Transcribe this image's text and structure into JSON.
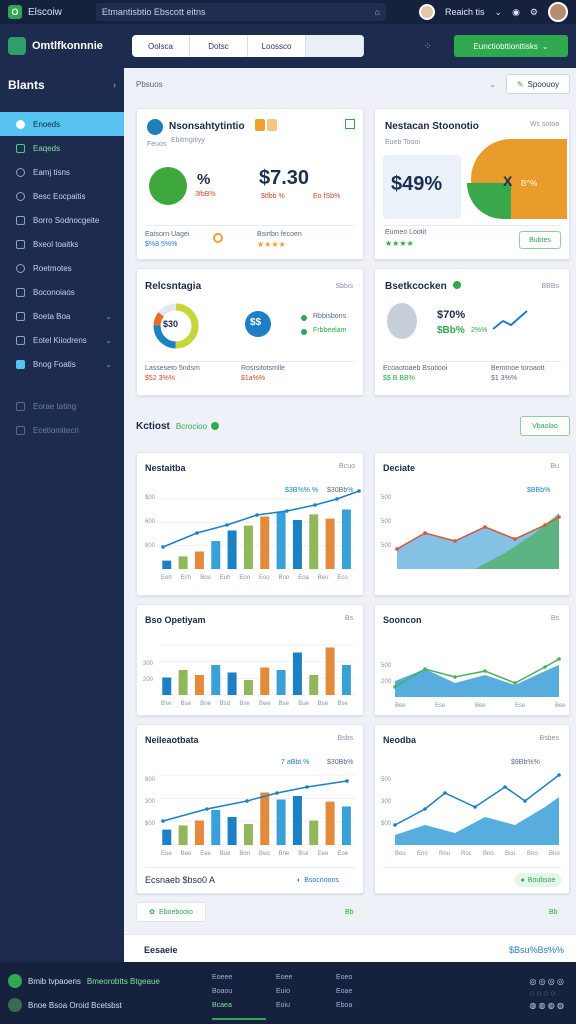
{
  "topbar": {
    "app_name": "Elscoiw",
    "search_text": "Etmantisbtio Ebscott eitns",
    "user_name": "Reaich tis"
  },
  "header": {
    "brand": "Omtlfkonnnie",
    "tabs": [
      "Oolsca",
      "Dotsc",
      "Loossco",
      ""
    ],
    "cta": "Eunctiobttionttisks"
  },
  "sidebar": {
    "title": "Blants",
    "items": [
      {
        "label": "Enoeds"
      },
      {
        "label": "Eaqeds"
      },
      {
        "label": "Eamj tisns"
      },
      {
        "label": "Besc Eocpaitis"
      },
      {
        "label": "Borro Sodnocgeite"
      },
      {
        "label": "Bxeol toaitks"
      },
      {
        "label": "Roetmotes"
      },
      {
        "label": "Boconoiaos"
      },
      {
        "label": "Boeta Boa"
      },
      {
        "label": "Eotel Kiiodrens"
      },
      {
        "label": "Bnog Foatis"
      },
      {
        "label": "Eorae tating"
      },
      {
        "label": "Ecetiomitecn"
      }
    ]
  },
  "filter": {
    "label": "Pbsuos",
    "button": "Spoouoy"
  },
  "cards": {
    "c1": {
      "title": "Nsonsahtytintio",
      "sub": "Feuos",
      "sub2": "Ebitmgitiyy",
      "badge": "%",
      "pct": "3fbB%",
      "value": "$7.30",
      "value_sub": "$tfbb %",
      "value_sub2": "Eo fSb%",
      "foot_left": "Eatsorn Uagei",
      "foot_left2": "$%8 5%%",
      "foot_right": "Bsirtbn fecoen"
    },
    "c2": {
      "title": "Nestacan Stoonotio",
      "tag": "Ws sotoa",
      "sub": "Eueb Toooi",
      "value": "$49%",
      "x": "X",
      "xp": "B^%",
      "foot": "Eumeo Lootit",
      "btn": "Bubtes"
    },
    "c3": {
      "title": "Relcsntagia",
      "tag": "Sbbis",
      "donut": "$30",
      "blue_txt": "$$",
      "item1": "Rbbisbons",
      "item2": "Frbbeelam",
      "foot_left": "Lasseseto 5ndsm",
      "foot_left2": "$52 3%%",
      "foot_right": "Rosrsitotsmlle",
      "foot_right2": "$1a%%"
    },
    "c4": {
      "title": "Bsetkcocken",
      "tag": "BBBs",
      "val": "$70%",
      "val2": "$Bb%",
      "val3": "2%%",
      "foot_left": "Ecoaotoaeb Bsotiooi",
      "foot_left2": "$$ B.BB%",
      "foot_right": "Bemtnoe toroaott",
      "foot_right2": "$1 3%%"
    }
  },
  "section": {
    "title": "Kctiost",
    "chip": "Bcrocioo",
    "button": "Vbaolao"
  },
  "charts": {
    "a": {
      "title": "Nestaitba",
      "tag": "Bcuo",
      "legend": "$3B%% %",
      "legend2": "$30Bb%",
      "ticks": [
        "Eeh",
        "Ech",
        "Bou",
        "Euh",
        "Eoo",
        "Eoo",
        "Bno",
        "Eoa",
        "Beo",
        "Eco"
      ]
    },
    "b": {
      "title": "Deciate",
      "tag": "Bu",
      "legend": "$BBb%"
    },
    "c": {
      "title": "Bso Opetiyam",
      "tag": "Bs",
      "ticks": [
        "Bse",
        "Bse",
        "Bne",
        "Bsd",
        "Bse",
        "Bwe",
        "Bse",
        "Bue",
        "Bse",
        "Bse"
      ]
    },
    "d": {
      "title": "Sooncon",
      "tag": "Bs",
      "ticks": [
        "Bee",
        "Ese",
        "Bee",
        "Ese",
        "Bee"
      ]
    },
    "e": {
      "title": "Neileaotbata",
      "tag": "Bsbs",
      "legend": "7 aBbt %",
      "legend2": "$30Bb%",
      "ticks": [
        "Eoe",
        "Bee",
        "Eee",
        "Bue",
        "Bon",
        "Bwc",
        "Bne",
        "Bce",
        "Eee",
        "Eoe"
      ]
    },
    "f": {
      "title": "Neodba",
      "tag": "Bsbes",
      "legend": "$9Bb%%",
      "ticks": [
        "Bou",
        "Eno",
        "Rnu",
        "Roc",
        "Bno",
        "Bcu",
        "Bno",
        "Bno"
      ]
    }
  },
  "bottom_cards": {
    "left_text": "Ecsnaeb $bso0 A",
    "left_btn": "Bsocnoons",
    "right_btn": "Boubsoe"
  },
  "pill_row": {
    "left": "Eboebooto",
    "right_tag": "Bb",
    "right_tag2": "Bb"
  },
  "bottom_total": {
    "label": "Eesaeie",
    "value": "$Bsu%Bs%%"
  },
  "footer": {
    "row1": "Bmib tvpaoens",
    "row1_green": "Bmeorobtts Btgeaue",
    "row2": "Bnoe Bsoa Oroid Bcetsbst",
    "col1": [
      "Eoeee",
      "Boaou",
      "Bcaea"
    ],
    "col2": [
      "Eoee",
      "Euio",
      "Eoiu"
    ],
    "col3": [
      "Eoeo",
      "Eoae",
      "Eboa"
    ]
  }
}
